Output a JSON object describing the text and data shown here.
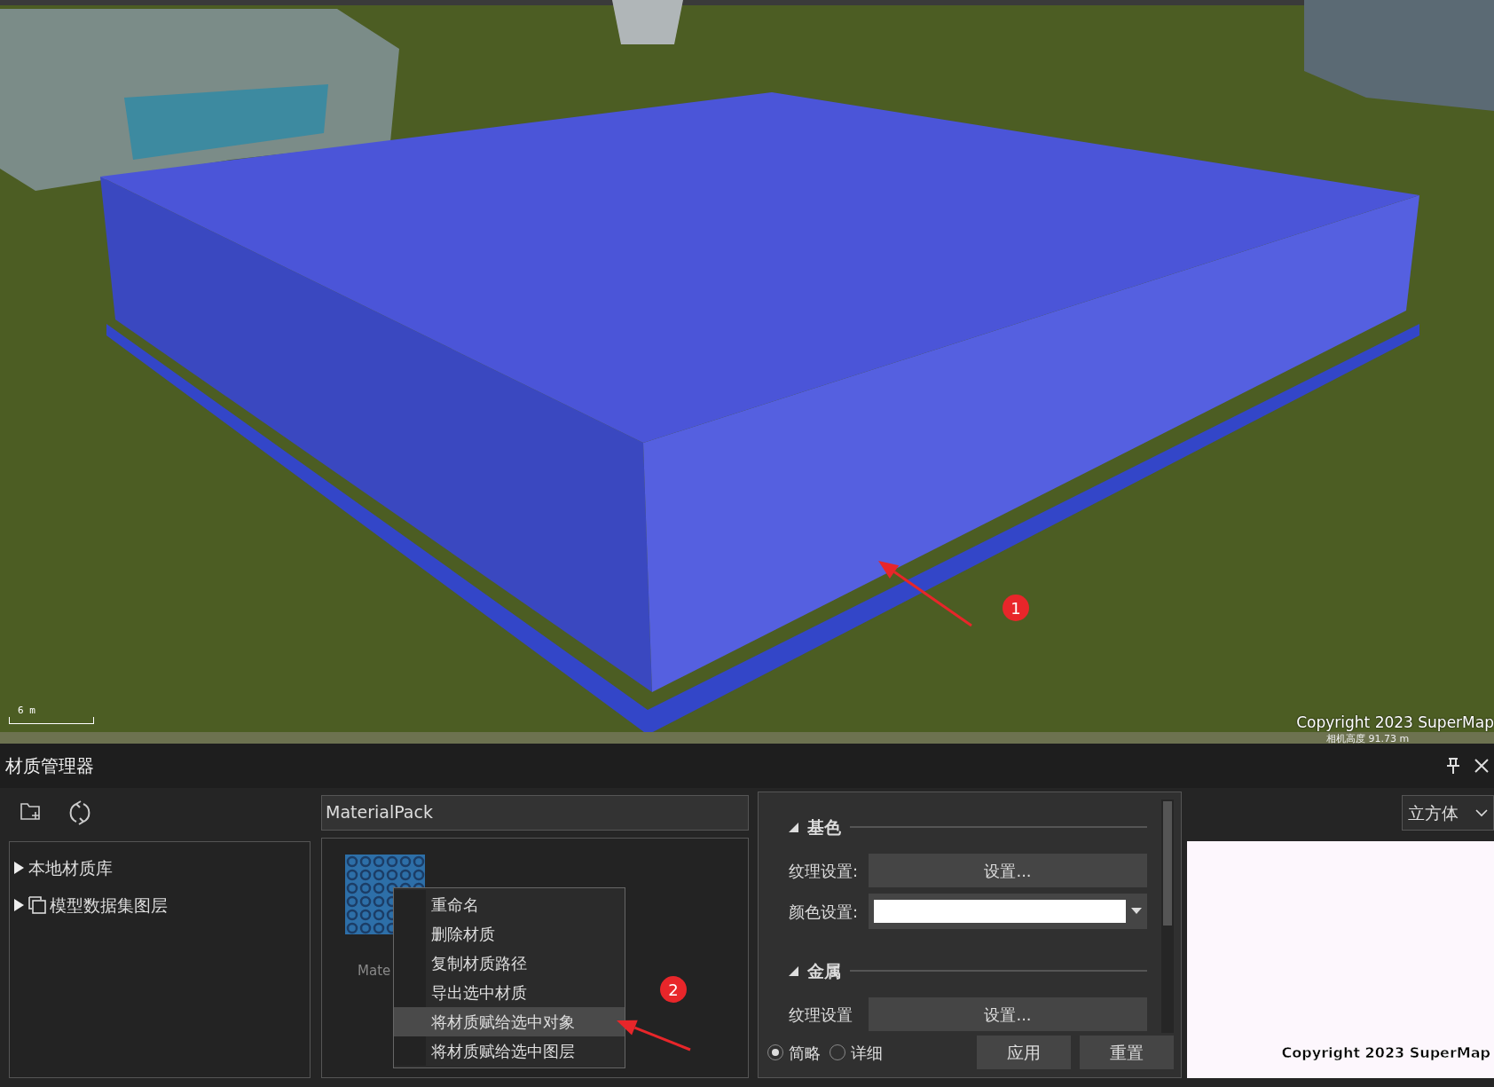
{
  "viewport": {
    "kind": "picture",
    "scale_label": "6 m",
    "copyright": "Copyright 2023 SuperMap",
    "camera_height": "相机高度 91.73 m"
  },
  "annotations": [
    {
      "label": "1"
    },
    {
      "label": "2"
    }
  ],
  "panel": {
    "title": "材质管理器"
  },
  "tree": [
    {
      "label": "本地材质库",
      "expanded": false,
      "kind": "folder"
    },
    {
      "label": "模型数据集图层",
      "expanded": false,
      "kind": "layers"
    }
  ],
  "library": {
    "value": "MaterialPack"
  },
  "materials": [
    {
      "label": "Mate",
      "selected": true
    }
  ],
  "context_menu": [
    {
      "label": "重命名",
      "selected": false
    },
    {
      "label": "删除材质",
      "selected": false
    },
    {
      "label": "复制材质路径",
      "selected": false
    },
    {
      "label": "导出选中材质",
      "selected": false
    },
    {
      "label": "将材质赋给选中对象",
      "selected": true
    },
    {
      "label": "将材质赋给选中图层",
      "selected": false
    }
  ],
  "properties": {
    "sections": [
      {
        "title": "基色",
        "expanded": true,
        "rows": [
          {
            "kind": "button",
            "label": "纹理设置:",
            "value": "设置..."
          },
          {
            "kind": "color",
            "label": "颜色设置:",
            "color": "#ffffff"
          }
        ]
      },
      {
        "title": "金属",
        "expanded": true,
        "rows": [
          {
            "kind": "button",
            "label": "纹理设置",
            "value": "设置..."
          }
        ]
      }
    ]
  },
  "view_mode": [
    {
      "label": "简略",
      "selected": true
    },
    {
      "label": "详细",
      "selected": false
    }
  ],
  "buttons": [
    "应用",
    "重置"
  ],
  "preview": {
    "shape": "立方体",
    "copyright": "Copyright 2023 SuperMap"
  }
}
